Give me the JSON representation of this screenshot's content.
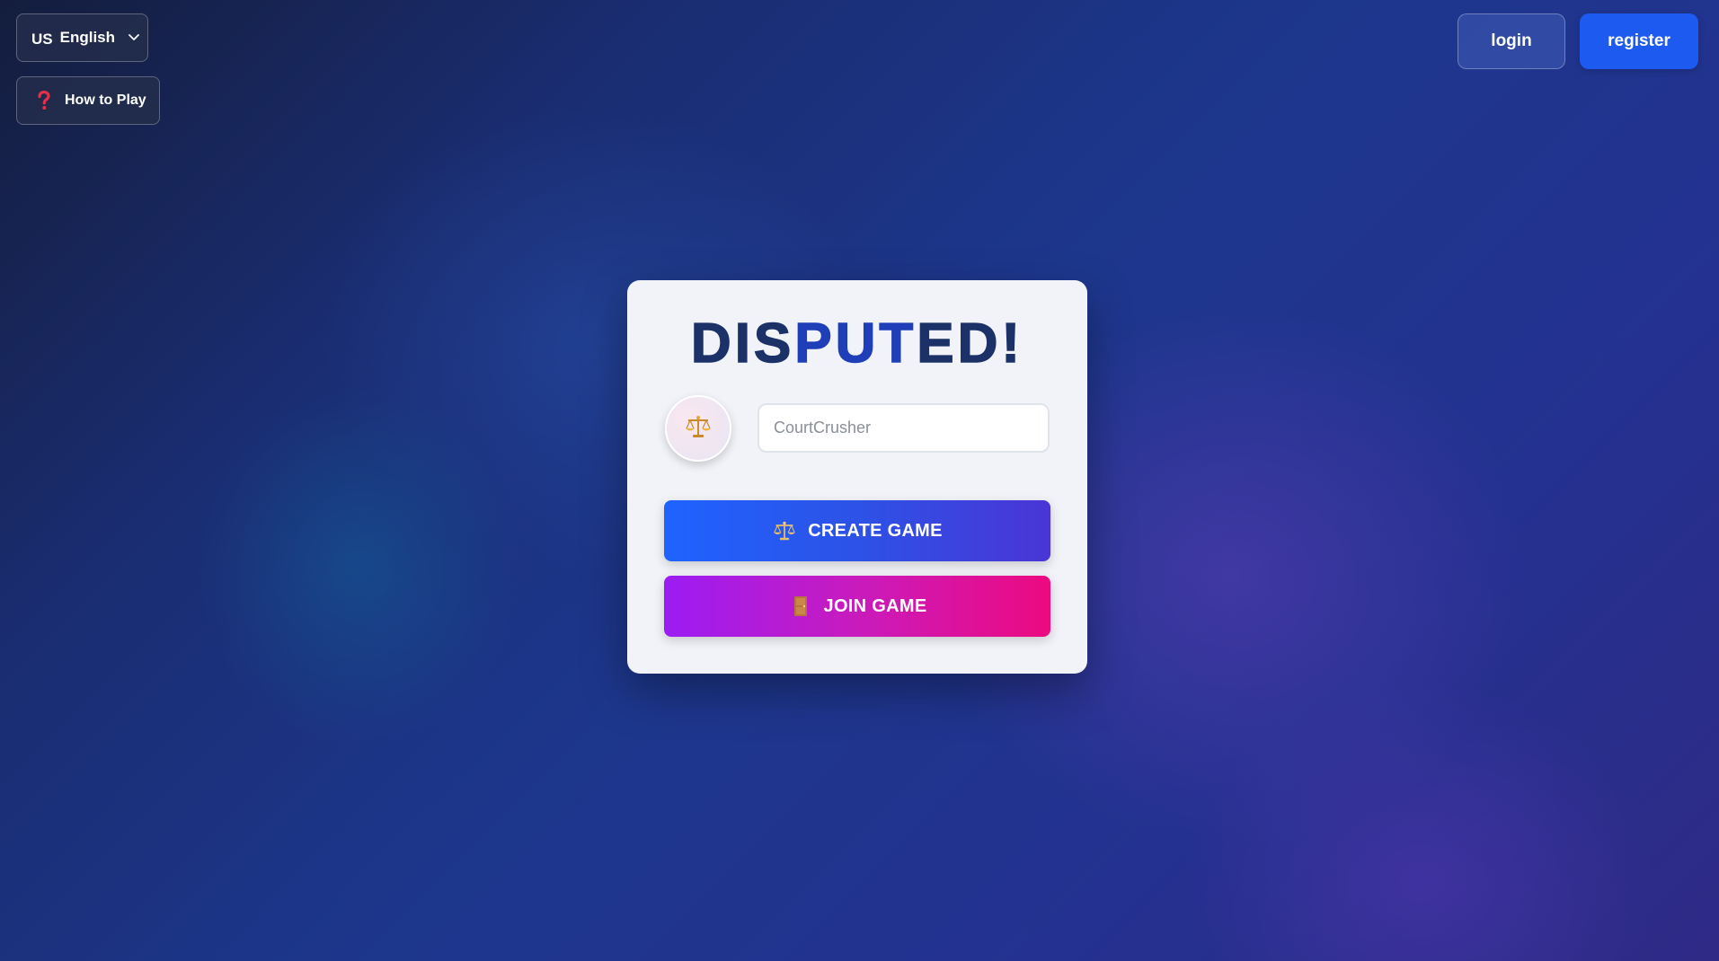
{
  "language": {
    "flag": "US",
    "label": "English",
    "icon": "chevron-down-icon"
  },
  "how_to_play": {
    "label": "How to Play",
    "icon": "question-mark-icon"
  },
  "auth": {
    "login_label": "login",
    "register_label": "register"
  },
  "card": {
    "title_part1": "DIS",
    "title_part2": "PUT",
    "title_part3": "ED!",
    "avatar_icon": "scales-icon",
    "name_input": {
      "placeholder": "CourtCrusher",
      "value": ""
    },
    "create_game_label": "CREATE GAME",
    "create_game_icon": "scales-icon",
    "join_game_label": "JOIN GAME",
    "join_game_icon": "door-icon"
  },
  "colors": {
    "primary_blue": "#1d5bf0",
    "title_dark": "#1b3167",
    "title_blue": "#1f3fb8",
    "join_gradient_start": "#9b1cf3",
    "join_gradient_end": "#ec0a80",
    "create_gradient_start": "#1f63ff",
    "create_gradient_end": "#4a35d6"
  }
}
